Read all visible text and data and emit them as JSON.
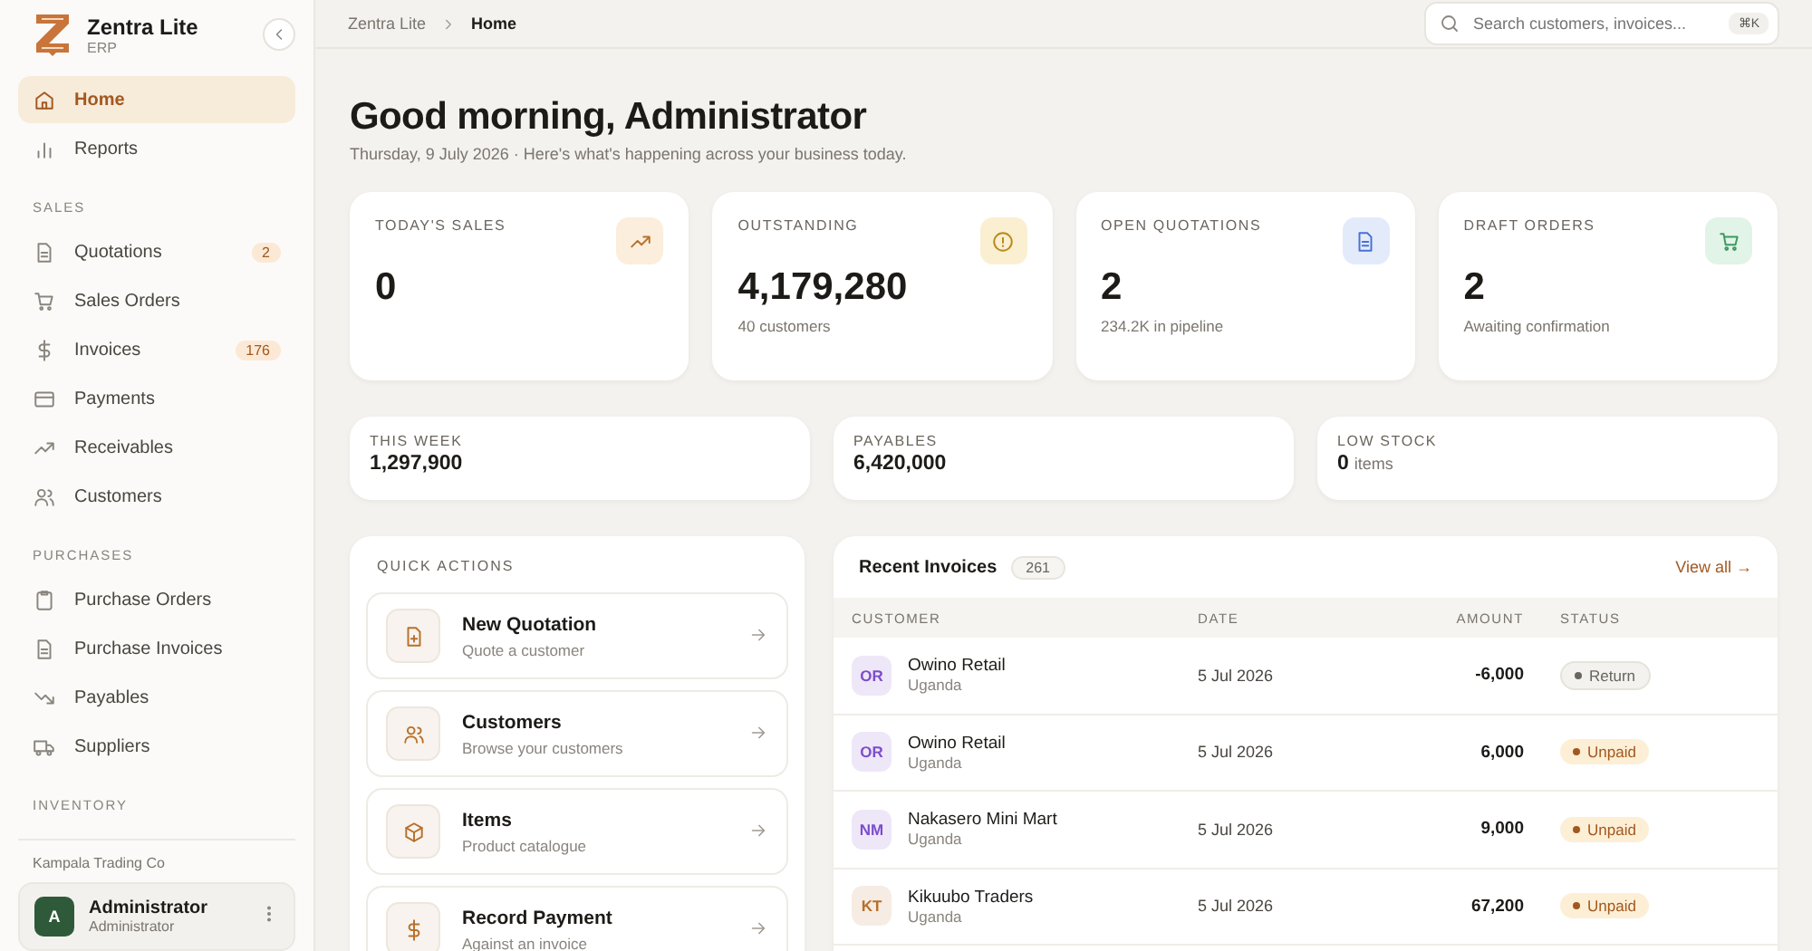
{
  "brand": {
    "name": "Zentra Lite",
    "subtitle": "ERP"
  },
  "sidebar": {
    "items": [
      {
        "label": "Home",
        "selected": true
      },
      {
        "label": "Reports",
        "selected": false
      }
    ],
    "sections": [
      {
        "title": "SALES",
        "items": [
          {
            "label": "Quotations",
            "badge": "2",
            "selected": false
          },
          {
            "label": "Sales Orders",
            "selected": false
          },
          {
            "label": "Invoices",
            "badge": "176",
            "selected": false
          },
          {
            "label": "Payments",
            "selected": false
          },
          {
            "label": "Receivables",
            "selected": false
          },
          {
            "label": "Customers",
            "selected": false
          }
        ]
      },
      {
        "title": "PURCHASES",
        "items": [
          {
            "label": "Purchase Orders",
            "selected": false
          },
          {
            "label": "Purchase Invoices",
            "selected": false
          },
          {
            "label": "Payables",
            "selected": false
          },
          {
            "label": "Suppliers",
            "selected": false
          }
        ]
      },
      {
        "title": "INVENTORY"
      }
    ],
    "company": "Kampala Trading Co",
    "user": {
      "initial": "A",
      "name": "Administrator",
      "role": "Administrator"
    }
  },
  "breadcrumb": [
    "Zentra Lite",
    "Home"
  ],
  "search": {
    "placeholder": "Search customers, invoices...",
    "shortcut": "⌘K"
  },
  "greeting": {
    "title": "Good morning, Administrator",
    "subtitle": "Thursday, 9 July 2026 · Here's what's happening across your business today."
  },
  "stat_cards": [
    {
      "label": "TODAY'S SALES",
      "value": "0",
      "color": "#fbeedd"
    },
    {
      "label": "OUTSTANDING",
      "value": "4,179,280",
      "note": "40 customers",
      "color": "#fbefd2"
    },
    {
      "label": "OPEN QUOTATIONS",
      "value": "2",
      "note": "234.2K in pipeline",
      "color": "#e3ebfb"
    },
    {
      "label": "DRAFT ORDERS",
      "value": "2",
      "note": "Awaiting confirmation",
      "color": "#e2f3e8"
    }
  ],
  "summary_cards": [
    {
      "label": "THIS WEEK",
      "value": "1,297,900"
    },
    {
      "label": "PAYABLES",
      "value": "6,420,000"
    },
    {
      "label": "LOW STOCK",
      "value": "0",
      "unit": "items"
    }
  ],
  "quick_actions": {
    "title": "QUICK ACTIONS",
    "items": [
      {
        "title": "New Quotation",
        "subtitle": "Quote a customer"
      },
      {
        "title": "Customers",
        "subtitle": "Browse your customers"
      },
      {
        "title": "Items",
        "subtitle": "Product catalogue"
      },
      {
        "title": "Record Payment",
        "subtitle": "Against an invoice"
      }
    ]
  },
  "recent_invoices": {
    "title": "Recent Invoices",
    "count": "261",
    "link": "View all →",
    "columns": [
      "CUSTOMER",
      "DATE",
      "AMOUNT",
      "STATUS"
    ],
    "rows": [
      {
        "initials": "OR",
        "color": "#7c4dcc",
        "customer": "Owino Retail",
        "country": "Uganda",
        "date": "5 Jul 2026",
        "amount": "-6,000",
        "status": {
          "label": "Return",
          "kind": "return"
        }
      },
      {
        "initials": "OR",
        "color": "#7c4dcc",
        "customer": "Owino Retail",
        "country": "Uganda",
        "date": "5 Jul 2026",
        "amount": "6,000",
        "status": {
          "label": "Unpaid",
          "kind": "unpaid"
        }
      },
      {
        "initials": "NM",
        "color": "#7c4dcc",
        "customer": "Nakasero Mini Mart",
        "country": "Uganda",
        "date": "5 Jul 2026",
        "amount": "9,000",
        "status": {
          "label": "Unpaid",
          "kind": "unpaid"
        }
      },
      {
        "initials": "KT",
        "color": "#b8702a",
        "customer": "Kikuubo Traders",
        "country": "Uganda",
        "date": "5 Jul 2026",
        "amount": "67,200",
        "status": {
          "label": "Unpaid",
          "kind": "unpaid"
        }
      }
    ]
  }
}
